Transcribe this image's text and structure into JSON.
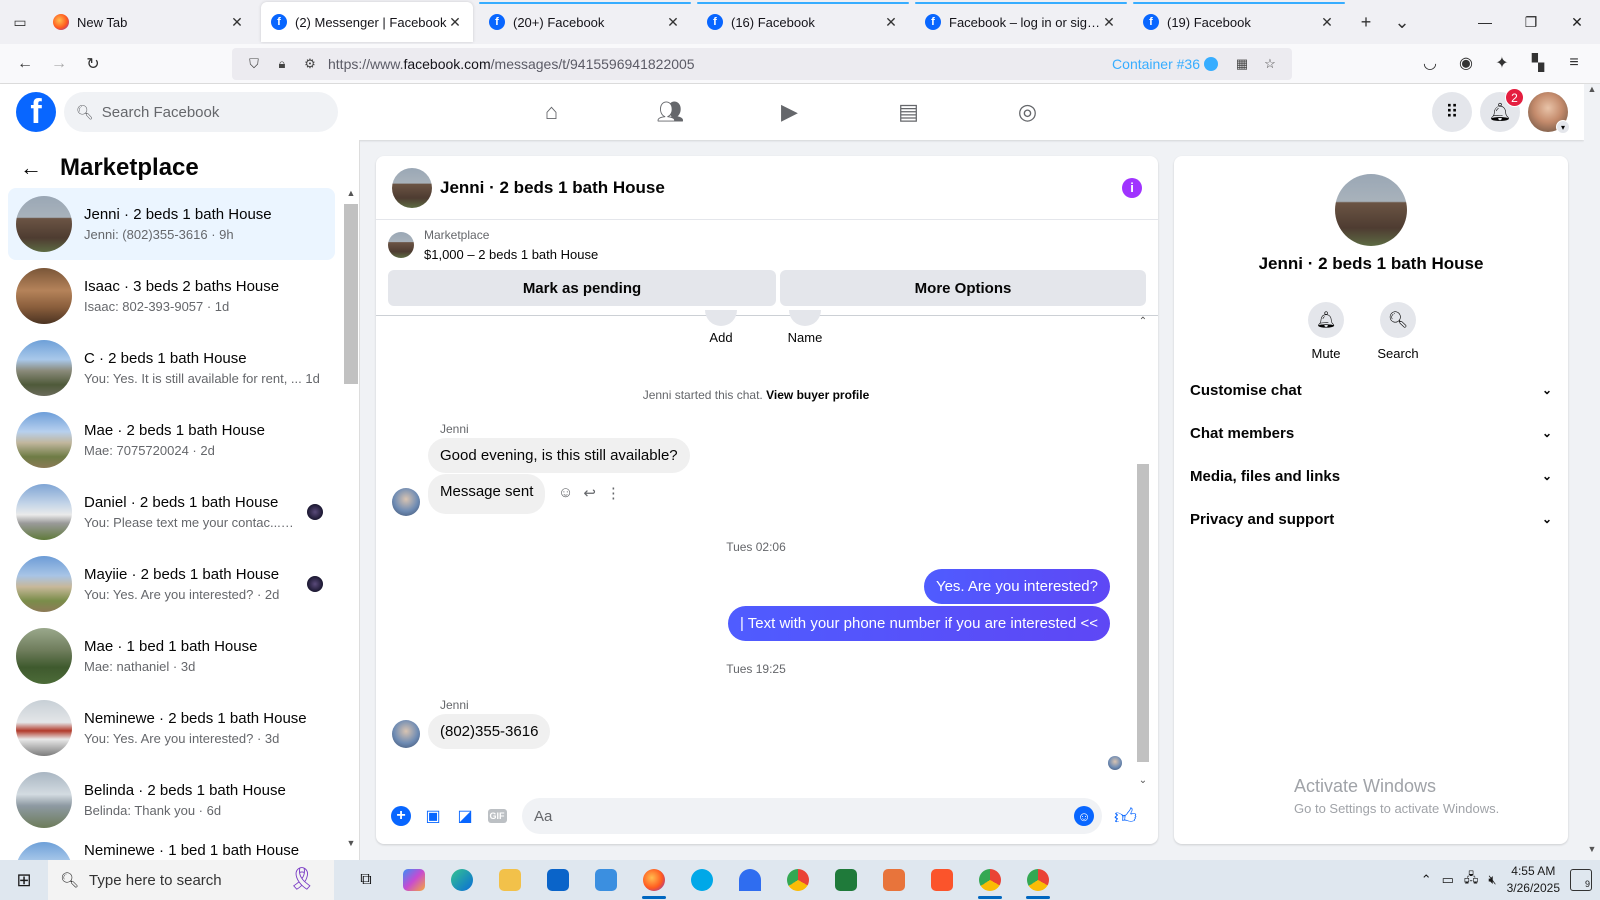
{
  "browser": {
    "tabs": [
      {
        "title": "New Tab",
        "favicon": "firefox-icon",
        "active": false
      },
      {
        "title": "(2) Messenger | Facebook",
        "favicon": "facebook-icon",
        "active": true
      },
      {
        "title": "(20+) Facebook",
        "favicon": "facebook-icon",
        "active": false
      },
      {
        "title": "(16) Facebook",
        "favicon": "facebook-icon",
        "active": false
      },
      {
        "title": "Facebook – log in or sign up",
        "favicon": "facebook-icon",
        "active": false
      },
      {
        "title": "(19) Facebook",
        "favicon": "facebook-icon",
        "active": false
      }
    ],
    "url_prefix": "https://www.",
    "url_domain": "facebook.com",
    "url_path": "/messages/t/9415596941822005",
    "container_label": "Container #36",
    "container_color": "#37adff"
  },
  "fb": {
    "search_placeholder": "Search Facebook",
    "notification_count": "2",
    "brand_color": "#0866ff"
  },
  "sidebar": {
    "title": "Marketplace",
    "conversations": [
      {
        "name": "Jenni · 2 beds 1 bath House",
        "snippet": "Jenni: (802)355-3616 · 9h"
      },
      {
        "name": "Isaac · 3 beds 2 baths House",
        "snippet": "Isaac: 802-393-9057 · 1d"
      },
      {
        "name": "C · 2 beds 1 bath House",
        "snippet": "You: Yes. It is still available for rent, ...",
        "time": "1d"
      },
      {
        "name": "Mae · 2 beds 1 bath House",
        "snippet": "Mae: 7075720024 · 2d"
      },
      {
        "name": "Daniel · 2 beds 1 bath House",
        "snippet": "You: Please text me your contac...",
        "time": "2d"
      },
      {
        "name": "Mayiie · 2 beds 1 bath House",
        "snippet": "You: Yes. Are you interested? · 2d"
      },
      {
        "name": "Mae · 1 bed 1 bath House",
        "snippet": "Mae: nathaniel · 3d"
      },
      {
        "name": "Neminewe · 2 beds 1 bath House",
        "snippet": "You: Yes. Are you interested? · 3d"
      },
      {
        "name": "Belinda · 2 beds 1 bath House",
        "snippet": "Belinda: Thank you · 6d"
      },
      {
        "name": "Neminewe · 1 bed 1 bath House",
        "snippet": ""
      }
    ]
  },
  "chat": {
    "title": "Jenni · 2 beds 1 bath House",
    "marketplace_label": "Marketplace",
    "listing": "$1,000 – 2 beds 1 bath House",
    "mark_pending": "Mark as pending",
    "more_options": "More Options",
    "top_actions": [
      "Add",
      "Name"
    ],
    "started_text": "Jenni started this chat.",
    "view_buyer": "View buyer profile",
    "sender_1": "Jenni",
    "msg_1": "Good evening, is this still available?",
    "msg_2": "Message sent",
    "time_1": "Tues 02:06",
    "out_1": "Yes. Are you interested?",
    "out_2": "| Text with your phone number if you are interested <<",
    "time_2": "Tues 19:25",
    "sender_2": "Jenni",
    "msg_3": "(802)355-3616",
    "composer_placeholder": "Aa",
    "outgoing_color": "#5a4bff"
  },
  "right_panel": {
    "name": "Jenni · 2 beds 1 bath House",
    "mute": "Mute",
    "search": "Search",
    "sections": [
      "Customise chat",
      "Chat members",
      "Media, files and links",
      "Privacy and support"
    ],
    "activate_title": "Activate Windows",
    "activate_sub": "Go to Settings to activate Windows."
  },
  "taskbar": {
    "search_placeholder": "Type here to search",
    "time": "4:55 AM",
    "date": "3/26/2025",
    "notif_count": "9"
  }
}
